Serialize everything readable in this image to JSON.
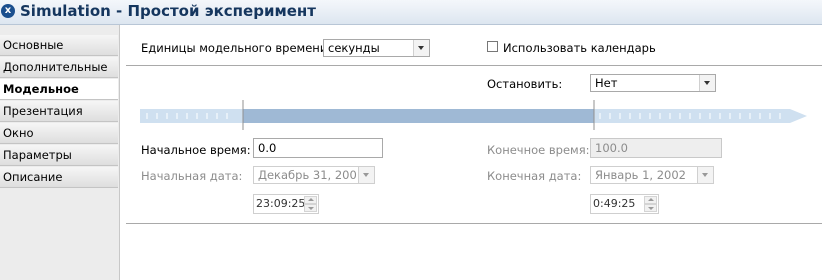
{
  "window": {
    "title": "Simulation - Простой эксперимент",
    "close_icon_glyph": "x"
  },
  "sidebar": {
    "items": [
      {
        "label": "Основные",
        "active": false
      },
      {
        "label": "Дополнительные",
        "active": false
      },
      {
        "label": "Модельное время",
        "active": true
      },
      {
        "label": "Презентация",
        "active": false
      },
      {
        "label": "Окно",
        "active": false
      },
      {
        "label": "Параметры",
        "active": false
      },
      {
        "label": "Описание",
        "active": false
      }
    ]
  },
  "model_time": {
    "units_label": "Единицы модельного времени:",
    "units_value": "секунды",
    "use_calendar_label": "Использовать календарь",
    "use_calendar_checked": false,
    "stop_label": "Остановить:",
    "stop_value": "Нет",
    "start_time_label": "Начальное время:",
    "start_time_value": "0.0",
    "end_time_label": "Конечное время:",
    "end_time_value": "100.0",
    "start_date_label": "Начальная дата:",
    "start_date_value": "Декабрь 31, 2001",
    "start_time_of_day": "23:09:25",
    "end_date_label": "Конечная дата:",
    "end_date_value": "Январь 1, 2002",
    "end_time_of_day": "0:49:25"
  },
  "colors": {
    "title_text": "#15365e",
    "timeline_light": "#cfe0f0",
    "timeline_dark": "#9fb9d5"
  }
}
